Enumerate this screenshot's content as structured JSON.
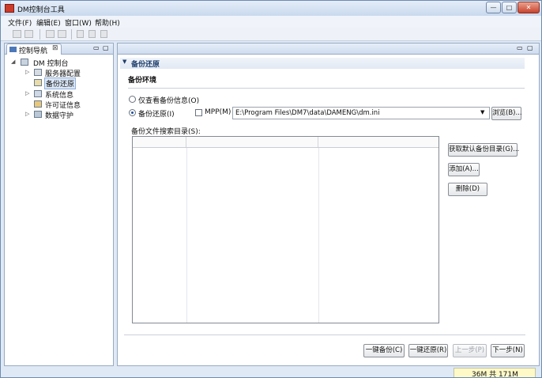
{
  "window": {
    "title": "DM控制台工具"
  },
  "menubar": {
    "items": [
      "文件(F)",
      "编辑(E)",
      "窗口(W)",
      "帮助(H)"
    ]
  },
  "toolbar": {
    "icons": [
      "new-icon",
      "copy-window-icon",
      "back-icon",
      "forward-icon",
      "cut-icon",
      "copy-icon",
      "paste-icon"
    ]
  },
  "nav": {
    "tab_label": "控制导航",
    "tab_close": "⊠",
    "root": "DM 控制台",
    "items": [
      {
        "label": "服务器配置",
        "icon": "server-config-icon",
        "expandable": true
      },
      {
        "label": "备份还原",
        "icon": "backup-restore-icon",
        "expandable": false,
        "selected": true
      },
      {
        "label": "系统信息",
        "icon": "system-info-icon",
        "expandable": true
      },
      {
        "label": "许可证信息",
        "icon": "license-icon",
        "expandable": false
      },
      {
        "label": "数据守护",
        "icon": "data-guard-icon",
        "expandable": true
      }
    ]
  },
  "main": {
    "section_title": "备份还原",
    "group_title": "备份环境",
    "radio_view": {
      "label": "仅查看备份信息(O)",
      "selected": false
    },
    "radio_restore": {
      "label": "备份还原(I)",
      "selected": true
    },
    "mpp": {
      "label": "MPP(M)",
      "checked": false
    },
    "ini_path": "E:\\Program Files\\DM7\\data\\DAMENG\\dm.ini",
    "browse_label": "浏览(B)...",
    "dir_label": "备份文件搜索目录(S):",
    "table": {
      "columns": [
        "",
        "",
        ""
      ],
      "rows": []
    },
    "btn_get_default": "获取默认备份目录(G)...",
    "btn_add": "添加(A)...",
    "btn_delete": "删除(D)",
    "btn_one_key_backup": "一键备份(C)",
    "btn_one_key_restore": "一键还原(R)",
    "btn_prev": "上一步(P)",
    "btn_next": "下一步(N)"
  },
  "status": {
    "memory": "36M 共 171M",
    "memory_used_fraction": 0.21
  }
}
